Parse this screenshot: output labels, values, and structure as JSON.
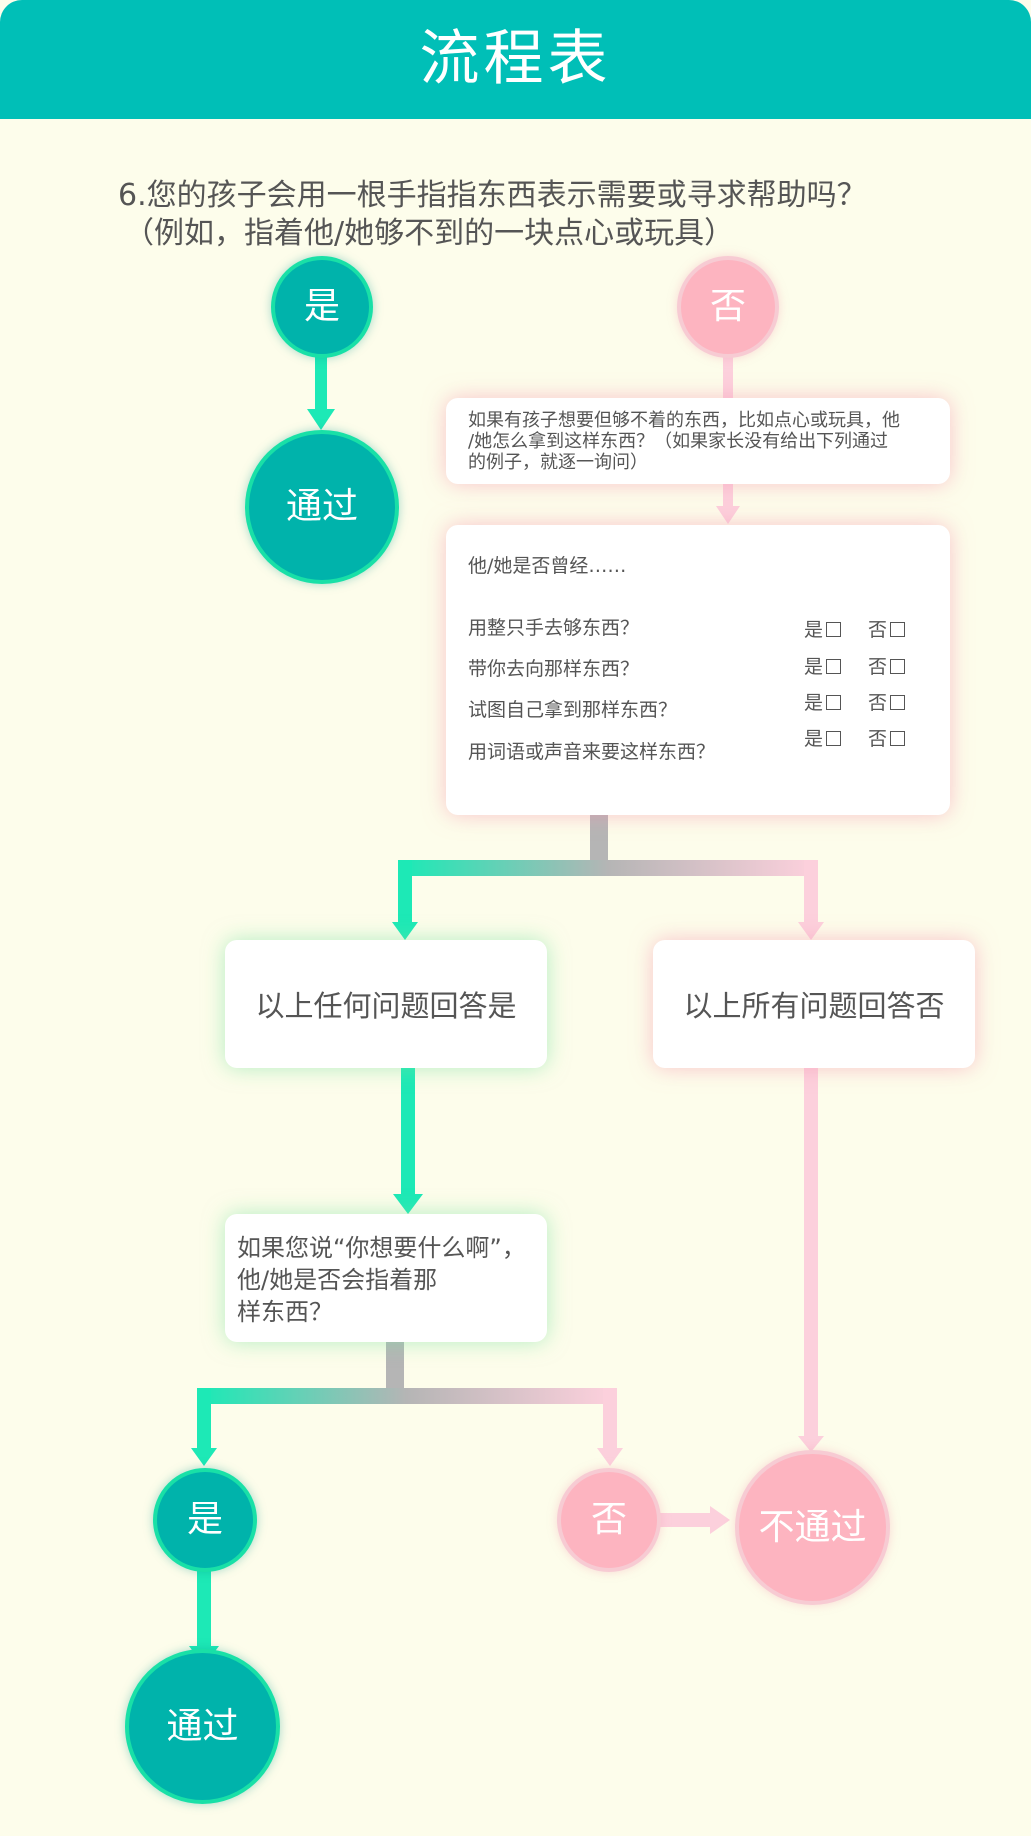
{
  "header": {
    "title": "流程表"
  },
  "question": {
    "line1": "6.您的孩子会用一根手指指东西表示需要或寻求帮助吗？",
    "line2": "（例如，指着他/她够不到的一块点心或玩具）"
  },
  "nodes": {
    "top_yes": "是",
    "top_no": "否",
    "pass_top": "通过",
    "how_get_line1": "如果有孩子想要但够不着的东西，比如点心或玩具，他",
    "how_get_line2": "/她怎么拿到这样东西？（如果家长没有给出下列通过",
    "how_get_line3": "的例子，就逐一询问）",
    "any_yes": "以上任何问题回答是",
    "all_no": "以上所有问题回答否",
    "if_you_say_line1": "如果您说“你想要什么啊”，",
    "if_you_say_line2": "他/她是否会指着那",
    "if_you_say_line3": "样东西？",
    "bottom_yes": "是",
    "bottom_no": "否",
    "pass_bottom": "通过",
    "fail": "不通过"
  },
  "checklist": {
    "intro": "他/她是否曾经……",
    "yes_label": "是",
    "no_label": "否",
    "items": [
      "用整只手去够东西？",
      "带你去向那样东西？",
      "试图自己拿到那样东西？",
      "用词语或声音来要这样东西？"
    ]
  },
  "colors": {
    "header_teal": "#00bfb7",
    "yes_teal": "#00b3ab",
    "arrow_green": "#1de9b6",
    "no_pink": "#fdb4c0",
    "arrow_pink": "#fcd0dc",
    "background": "#fdfdeb"
  }
}
